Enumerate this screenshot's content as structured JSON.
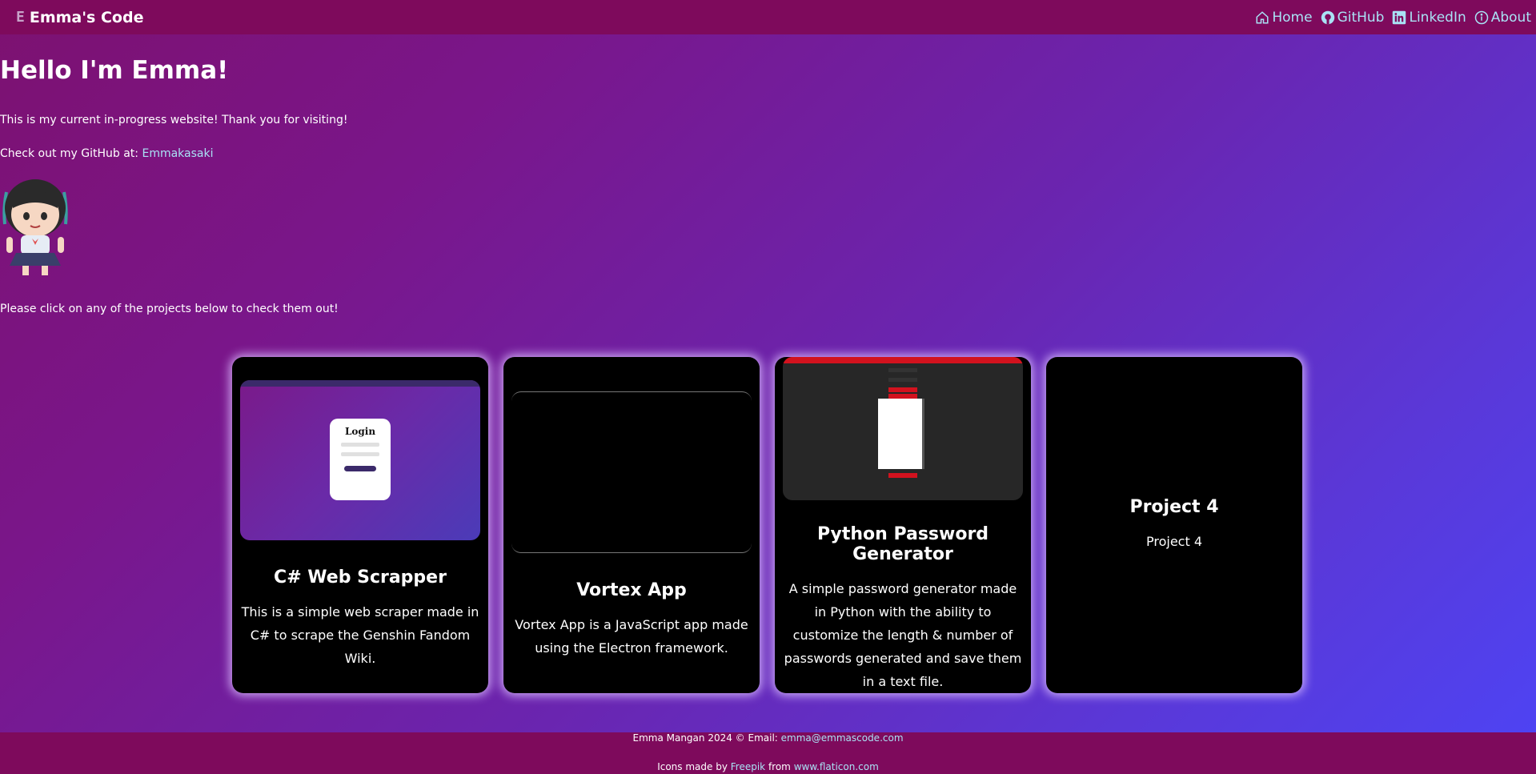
{
  "nav": {
    "brand_logo": "E",
    "brand_name": "Emma's Code",
    "links": [
      {
        "label": "Home",
        "icon": "home-icon"
      },
      {
        "label": "GitHub",
        "icon": "github-icon"
      },
      {
        "label": "LinkedIn",
        "icon": "linkedin-icon"
      },
      {
        "label": "About",
        "icon": "info-icon"
      }
    ]
  },
  "intro": {
    "heading": "Hello I'm Emma!",
    "line1": "This is my current in-progress website! Thank you for visiting!",
    "github_prefix": "Check out my GitHub at: ",
    "github_link": "Emmakasaki",
    "projects_prompt": "Please click on any of the projects below to check them out!"
  },
  "projects": [
    {
      "title": "C# Web Scrapper",
      "description": "This is a simple web scraper made in C# to scrape the Genshin Fandom Wiki.",
      "media_text": "Login"
    },
    {
      "title": "Vortex App",
      "description": "Vortex App is a JavaScript app made using the Electron framework."
    },
    {
      "title": "Python Password Generator",
      "description": "A simple password generator made in Python with the ability to customize the length & number of passwords generated and save them in a text file."
    },
    {
      "title": "Project 4",
      "description": "Project 4"
    }
  ],
  "footer": {
    "copyright_prefix": "Emma Mangan 2024 © Email: ",
    "email": "emma@emmascode.com",
    "credit_prefix": "Icons made by ",
    "credit_author": "Freepik",
    "credit_mid": " from ",
    "credit_site": "www.flaticon.com"
  },
  "colors": {
    "navbar": "#7e0a5c",
    "link": "#a9e2f5",
    "card": "#000000",
    "card_glow": "#dcbeff"
  }
}
